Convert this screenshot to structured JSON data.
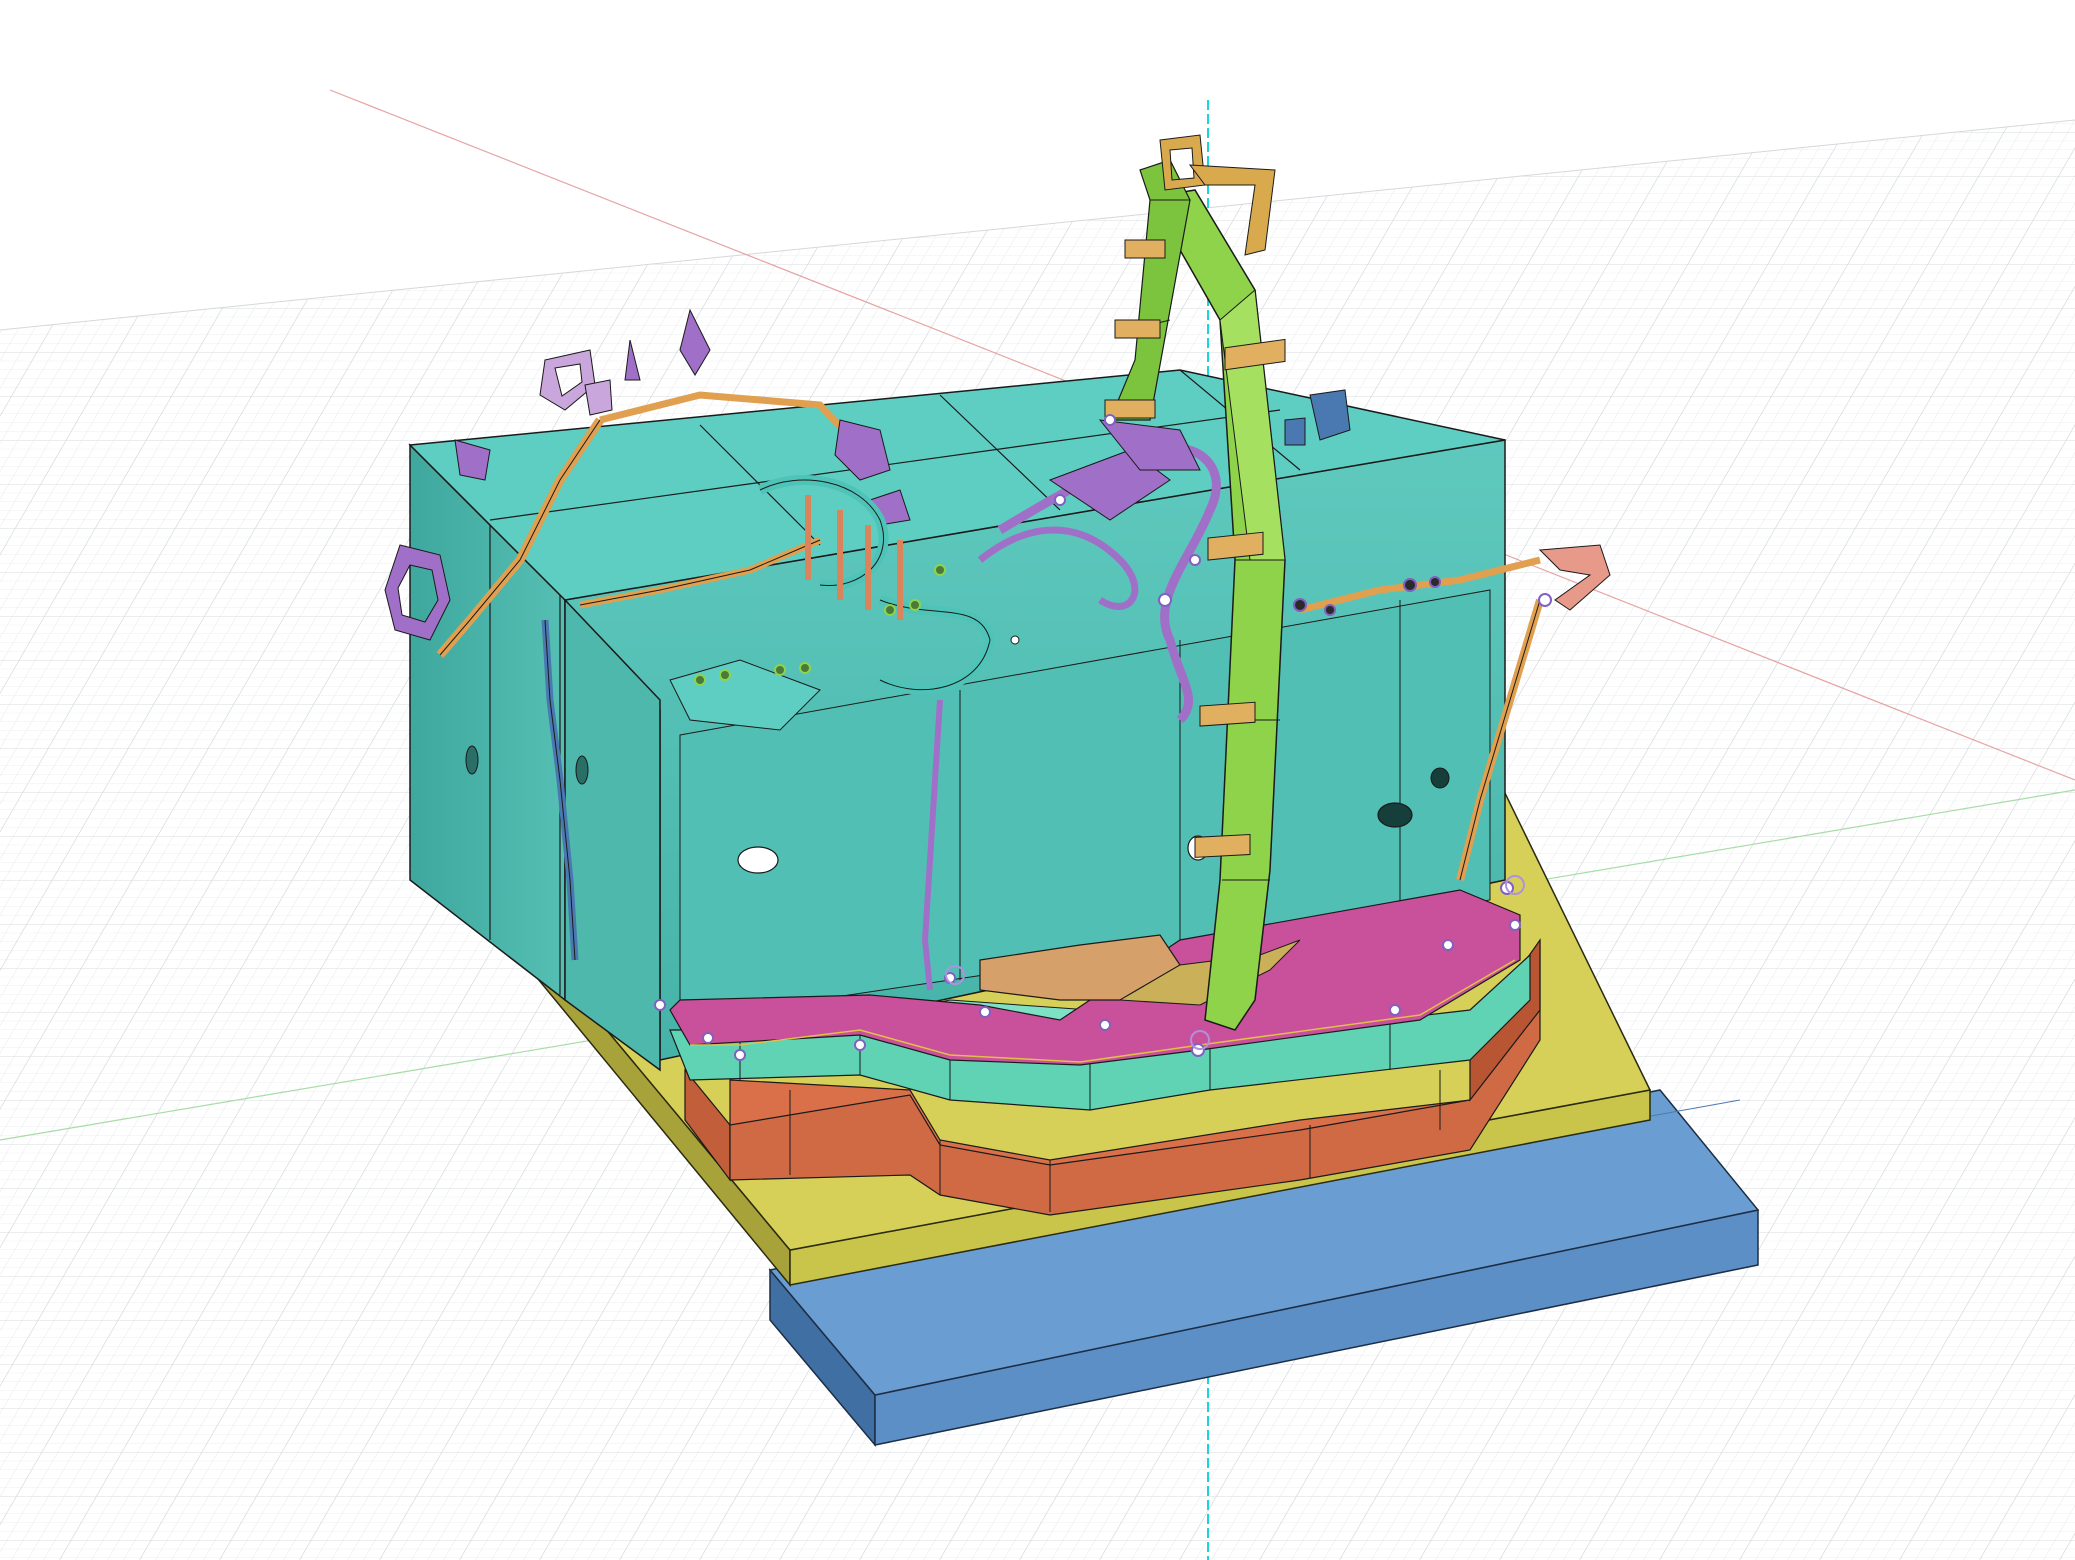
{
  "app": {
    "view": "3d-viewport",
    "visible_text": []
  },
  "colors": {
    "background": "#ffffff",
    "grid_line": "#d9dde0",
    "grid_major": "#c4c8cc",
    "axis_x": "#e8a0a0",
    "axis_y": "#9ad49a",
    "axis_z": "#19d3e0",
    "enclosure": "#4ec3b8",
    "enclosure_top": "#5dcec4",
    "base_plate_blue": "#5b8fc6",
    "platform_yellow": "#c9c44a",
    "terrain_orange": "#d9704a",
    "terrain_mint": "#5fd3b4",
    "terrain_magenta": "#c9509a",
    "ramp_tan": "#d4a46a",
    "tower_green": "#8fd34a",
    "bracket_tan": "#d9a94e",
    "track_purple": "#a070c8",
    "track_lavender": "#c9a6dc",
    "track_orange": "#e0a050",
    "bracket_pink": "#e89a8a",
    "bracket_blue": "#4a78b0",
    "edge_line": "#1a1a1a"
  },
  "model": {
    "components": [
      "base-plate",
      "platform",
      "terrain-base",
      "terrain-mid",
      "terrain-top",
      "enclosure",
      "tower",
      "track-network",
      "mounting-holes",
      "joint-markers"
    ]
  }
}
